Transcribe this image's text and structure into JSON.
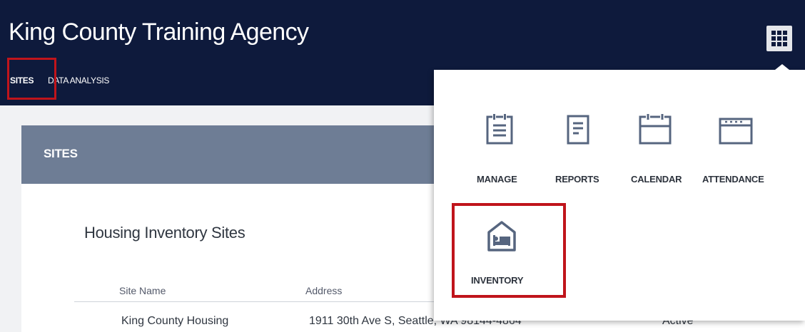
{
  "header": {
    "title": "King County Training Agency",
    "tabs": [
      {
        "label": "SITES",
        "active": true
      },
      {
        "label": "DATA ANALYSIS",
        "active": false
      }
    ],
    "apps_icon": "grid-icon"
  },
  "panel": {
    "header_title": "SITES",
    "section_title": "Housing Inventory Sites",
    "columns": [
      "Site Name",
      "Address"
    ],
    "rows": [
      {
        "site_name": "King County Housing",
        "address": "1911 30th Ave S, Seattle, WA 98144-4864",
        "status": "Active"
      }
    ]
  },
  "app_menu": {
    "items": [
      {
        "label": "MANAGE",
        "icon": "clipboard-list-icon"
      },
      {
        "label": "REPORTS",
        "icon": "document-icon"
      },
      {
        "label": "CALENDAR",
        "icon": "calendar-icon"
      },
      {
        "label": "ATTENDANCE",
        "icon": "attendance-icon"
      },
      {
        "label": "INVENTORY",
        "icon": "house-bed-icon"
      }
    ]
  },
  "colors": {
    "header_bg": "#0e1a3c",
    "panel_header_bg": "#6e7d95",
    "highlight": "#c0141b",
    "icon_stroke": "#56657f"
  }
}
